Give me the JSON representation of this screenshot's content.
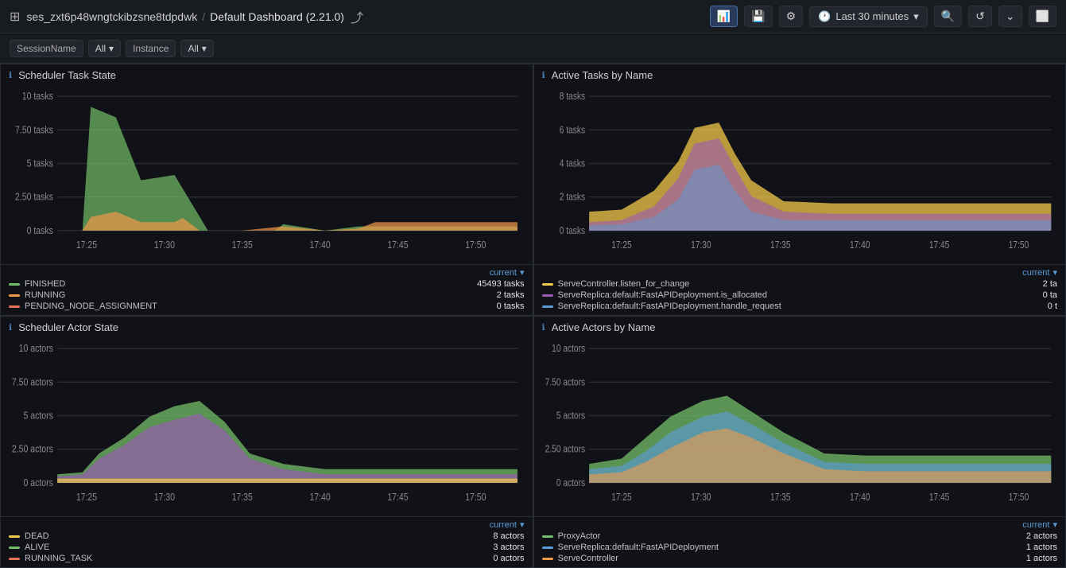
{
  "topbar": {
    "grid_icon": "⊞",
    "workspace": "ses_zxt6p48wngtckibzsne8tdpdwk",
    "separator": "/",
    "title": "Default Dashboard (2.21.0)",
    "share_icon": "⤴",
    "time_label": "Last 30 minutes",
    "icons": {
      "chart": "📊",
      "save": "💾",
      "gear": "⚙",
      "clock": "🕐",
      "search": "🔍",
      "refresh": "↺",
      "chevron": "⌄",
      "display": "⬜"
    }
  },
  "filterbar": {
    "session_label": "SessionName",
    "session_value": "All",
    "instance_label": "Instance",
    "instance_value": "All"
  },
  "panels": [
    {
      "id": "scheduler-task-state",
      "title": "Scheduler Task State",
      "y_labels": [
        "10 tasks",
        "7.50 tasks",
        "5 tasks",
        "2.50 tasks",
        "0 tasks"
      ],
      "x_labels": [
        "17:25",
        "17:30",
        "17:35",
        "17:40",
        "17:45",
        "17:50"
      ],
      "current_link": "current",
      "legend": [
        {
          "color": "#73bf69",
          "label": "FINISHED",
          "value": "45493 tasks"
        },
        {
          "color": "#f2994a",
          "label": "RUNNING",
          "value": "2 tasks"
        },
        {
          "color": "#e8735a",
          "label": "PENDING_NODE_ASSIGNMENT",
          "value": "0 tasks"
        }
      ]
    },
    {
      "id": "active-tasks-by-name",
      "title": "Active Tasks by Name",
      "y_labels": [
        "8 tasks",
        "6 tasks",
        "4 tasks",
        "2 tasks",
        "0 tasks"
      ],
      "x_labels": [
        "17:25",
        "17:30",
        "17:35",
        "17:40",
        "17:45",
        "17:50"
      ],
      "current_link": "current",
      "legend": [
        {
          "color": "#f2c94c",
          "label": "ServeController.listen_for_change",
          "value": "2 ta"
        },
        {
          "color": "#9b59b6",
          "label": "ServeReplica:default:FastAPIDeployment.is_allocated",
          "value": "0 ta"
        },
        {
          "color": "#5b9bd5",
          "label": "ServeReplica:default:FastAPIDeployment.handle_request",
          "value": "0 t"
        }
      ]
    },
    {
      "id": "scheduler-actor-state",
      "title": "Scheduler Actor State",
      "y_labels": [
        "10 actors",
        "7.50 actors",
        "5 actors",
        "2.50 actors",
        "0 actors"
      ],
      "x_labels": [
        "17:25",
        "17:30",
        "17:35",
        "17:40",
        "17:45",
        "17:50"
      ],
      "current_link": "current",
      "legend": [
        {
          "color": "#f2c94c",
          "label": "DEAD",
          "value": "8 actors"
        },
        {
          "color": "#73bf69",
          "label": "ALIVE",
          "value": "3 actors"
        },
        {
          "color": "#e8735a",
          "label": "RUNNING_TASK",
          "value": "0 actors"
        }
      ]
    },
    {
      "id": "active-actors-by-name",
      "title": "Active Actors by Name",
      "y_labels": [
        "10 actors",
        "7.50 actors",
        "5 actors",
        "2.50 actors",
        "0 actors"
      ],
      "x_labels": [
        "17:25",
        "17:30",
        "17:35",
        "17:40",
        "17:45",
        "17:50"
      ],
      "current_link": "current",
      "legend": [
        {
          "color": "#73bf69",
          "label": "ProxyActor",
          "value": "2 actors"
        },
        {
          "color": "#5b9bd5",
          "label": "ServeReplica:default:FastAPIDeployment",
          "value": "1 actors"
        },
        {
          "color": "#f2994a",
          "label": "ServeController",
          "value": "1 actors"
        }
      ]
    }
  ]
}
